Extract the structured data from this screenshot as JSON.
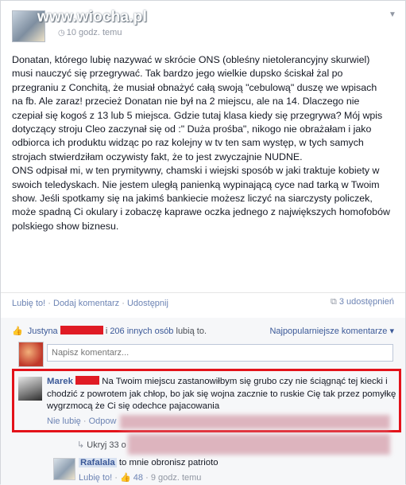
{
  "header": {
    "watermark": "www.wiocha.pl",
    "timestamp": "10 godz. temu"
  },
  "post": {
    "paragraph1": "Donatan, którego lubię nazywać w skrócie ONS (obleśny nietolerancyjny skurwiel) musi nauczyć się przegrywać. Tak bardzo jego wielkie dupsko ściskał żal po przegraniu z Conchitą, że musiał obnażyć całą swoją \"cebulową\" duszę we wpisach na fb. Ale zaraz! przecież Donatan nie był na 2 miejscu, ale na 14. Dlaczego nie czepiał się kogoś z 13 lub 5 miejsca. Gdzie tutaj klasa kiedy się przegrywa? Mój wpis dotyczący stroju Cleo zaczynał się od :\" Duża prośba\", nikogo nie obrażałam i jako odbiorca ich produktu widząc po raz kolejny w tv ten sam występ, w tych samych strojach stwierdziłam oczywisty fakt, że to jest zwyczajnie NUDNE.",
    "paragraph2": "ONS odpisał mi, w ten prymitywny, chamski i wiejski sposób w jaki traktuje kobiety w swoich teledyskach. Nie jestem uległą panienką wypinającą cyce nad tarką w Twoim show. Jeśli spotkamy się na jakimś bankiecie możesz liczyć na siarczysty policzek, może spadną Ci okulary i zobaczę kaprawe oczka jednego z największych homofobów polskiego show biznesu."
  },
  "actions": {
    "like": "Lubię to!",
    "comment": "Dodaj komentarz",
    "share": "Udostępnij",
    "shares_count": "3 udostępnień"
  },
  "likes": {
    "first_name": "Justyna",
    "others": "206 innych osób",
    "suffix": "lubią to."
  },
  "sort": {
    "label": "Najpopularniejsze komentarze"
  },
  "comment_input": {
    "placeholder": "Napisz komentarz..."
  },
  "comment": {
    "author": "Marek",
    "text": "Na Twoim miejscu zastanowiłbym się grubo czy nie ściągnąć tej kiecki i chodzić z powrotem jak chłop, bo jak się wojna zacznie to ruskie Cię tak przez pomyłkę wygrzmocą że Ci się odechce pajacowania",
    "unlike": "Nie lubię",
    "reply": "Odpow"
  },
  "replies_toggle": {
    "label": "Ukryj 33 o"
  },
  "reply": {
    "author": "Rafalala",
    "text": "to mnie obronisz patrioto",
    "like": "Lubię to!",
    "likes_count": "48",
    "time": "9 godz. temu"
  },
  "colors": {
    "link": "#3b5998",
    "redaction": "#e01b24",
    "highlight": "#e3121a"
  }
}
